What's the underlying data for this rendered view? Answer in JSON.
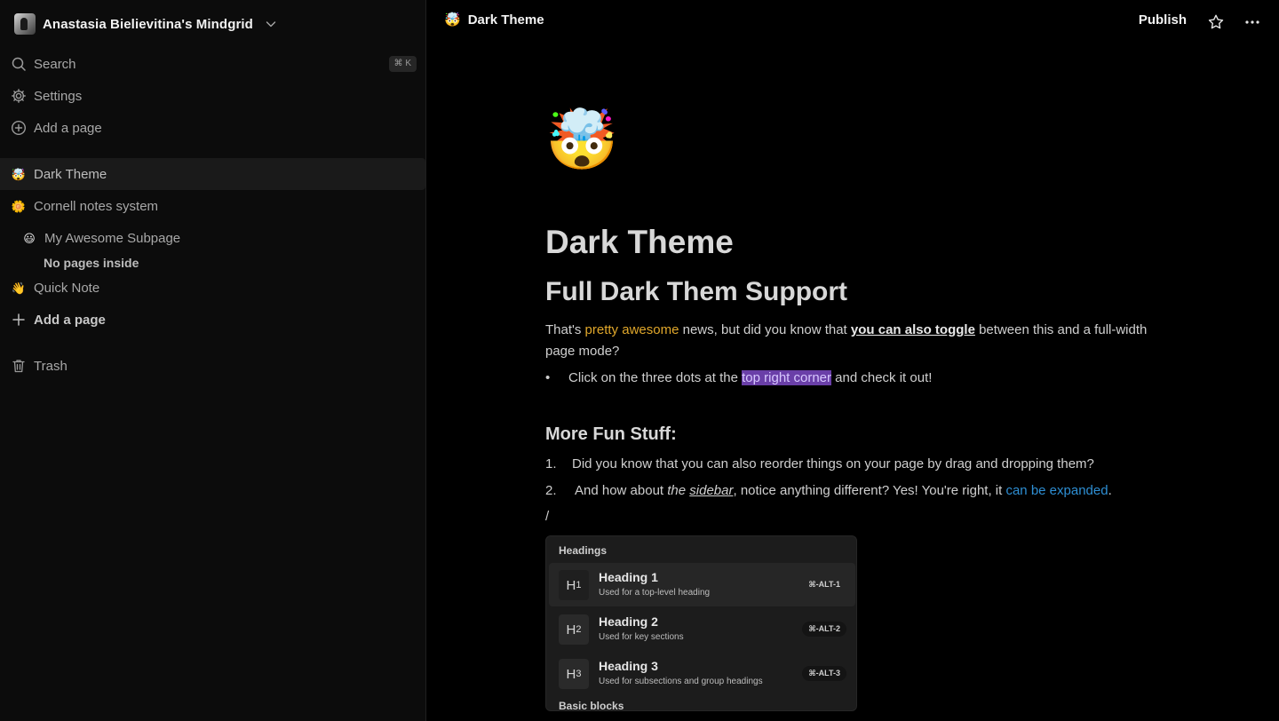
{
  "sidebar": {
    "workspace_name": "Anastasia Bielievitina's Mindgrid",
    "search": {
      "label": "Search",
      "shortcut": "⌘ K"
    },
    "settings_label": "Settings",
    "add_page_top_label": "Add a page",
    "pages": [
      {
        "emoji": "🤯",
        "label": "Dark Theme"
      },
      {
        "emoji": "🌼",
        "label": "Cornell notes system"
      },
      {
        "emoji": "😃",
        "label": "My Awesome Subpage"
      },
      {
        "emoji": "👋",
        "label": "Quick Note"
      }
    ],
    "no_pages_inside": "No pages inside",
    "add_page_bottom_label": "Add a page",
    "trash_label": "Trash"
  },
  "topbar": {
    "page_emoji": "🤯",
    "page_title": "Dark Theme",
    "publish_label": "Publish"
  },
  "doc": {
    "cover_emoji": "🤯",
    "title": "Dark Theme",
    "subtitle": "Full Dark Them Support",
    "para": {
      "part1": "That's ",
      "highlight_yellow": "pretty awesome",
      "part2": " news, but did you know that ",
      "bold_underline": "you can also toggle",
      "part3": " between this and a full-width page mode?"
    },
    "bullet": {
      "marker": "•",
      "part1": "Click on the three dots at the ",
      "highlight_purple": "top right corner",
      "part2": " and check it out!"
    },
    "more_heading": "More Fun Stuff:",
    "list": [
      {
        "num": "1.",
        "text": "Did you know that you can also reorder things on your page by drag and dropping them?"
      },
      {
        "num": "2.",
        "part1": "And how about ",
        "italic": "the",
        "italic_underline": "sidebar",
        "part2": ", notice anything different? Yes! You're right, it ",
        "link": "can be expanded",
        "part3": "."
      }
    ],
    "slash": "/"
  },
  "slash_menu": {
    "section_headings": "Headings",
    "items": [
      {
        "icon": "H",
        "sub": "1",
        "title": "Heading 1",
        "desc": "Used for a top-level heading",
        "shortcut": "⌘-ALT-1"
      },
      {
        "icon": "H",
        "sub": "2",
        "title": "Heading 2",
        "desc": "Used for key sections",
        "shortcut": "⌘-ALT-2"
      },
      {
        "icon": "H",
        "sub": "3",
        "title": "Heading 3",
        "desc": "Used for subsections and group headings",
        "shortcut": "⌘-ALT-3"
      }
    ],
    "section_basic": "Basic blocks"
  },
  "colors": {
    "accent_yellow": "#e0a72b",
    "accent_blue": "#2e8fd4",
    "highlight_purple": "#6a3fa8"
  }
}
